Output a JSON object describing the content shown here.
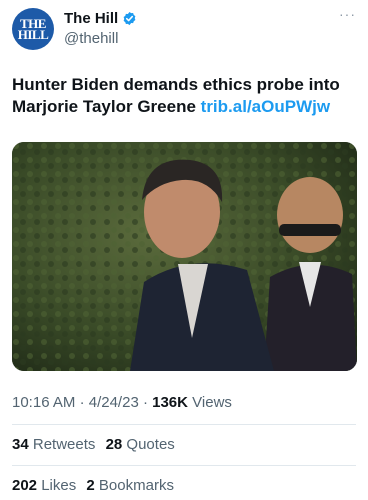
{
  "account": {
    "avatar_line1": "THE",
    "avatar_line2": "HILL",
    "name": "The Hill",
    "handle": "@thehill",
    "more": "···"
  },
  "tweet": {
    "text": "Hunter Biden demands ethics probe into Marjorie Taylor Greene",
    "link": "trib.al/aOuPWjw"
  },
  "meta": {
    "time": "10:16 AM",
    "date": "4/24/23",
    "views_count": "136K",
    "views_label": "Views",
    "sep": "·"
  },
  "engagement": {
    "retweets_count": "34",
    "retweets_label": "Retweets",
    "quotes_count": "28",
    "quotes_label": "Quotes",
    "likes_count": "202",
    "likes_label": "Likes",
    "bookmarks_count": "2",
    "bookmarks_label": "Bookmarks"
  },
  "colors": {
    "link": "#1d9bf0",
    "verified": "#1d9bf0",
    "avatar_bg": "#1d5aa8",
    "muted": "#536471"
  }
}
